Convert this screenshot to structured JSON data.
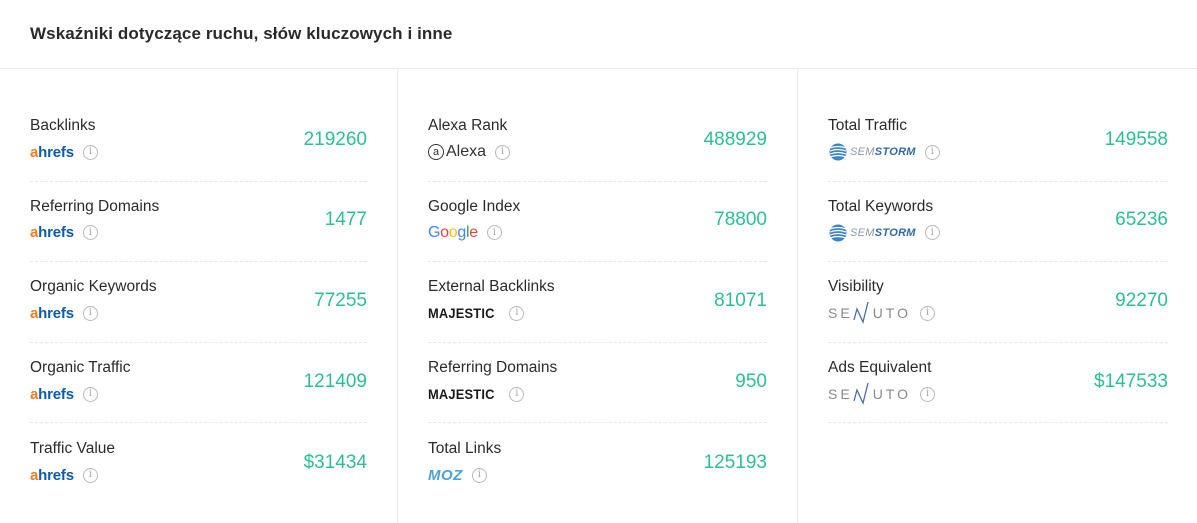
{
  "header": {
    "title": "Wskaźniki dotyczące ruchu, słów kluczowych i inne"
  },
  "columns": [
    {
      "rows": [
        {
          "label": "Backlinks",
          "source": "ahrefs",
          "value": "219260"
        },
        {
          "label": "Referring Domains",
          "source": "ahrefs",
          "value": "1477"
        },
        {
          "label": "Organic Keywords",
          "source": "ahrefs",
          "value": "77255"
        },
        {
          "label": "Organic Traffic",
          "source": "ahrefs",
          "value": "121409"
        },
        {
          "label": "Traffic Value",
          "source": "ahrefs",
          "value": "$31434"
        }
      ]
    },
    {
      "rows": [
        {
          "label": "Alexa Rank",
          "source": "Alexa",
          "value": "488929"
        },
        {
          "label": "Google Index",
          "source": "Google",
          "value": "78800"
        },
        {
          "label": "External Backlinks",
          "source": "MAJESTIC",
          "value": "81071"
        },
        {
          "label": "Referring Domains",
          "source": "MAJESTIC",
          "value": "950"
        },
        {
          "label": "Total Links",
          "source": "MOZ",
          "value": "125193"
        }
      ]
    },
    {
      "rows": [
        {
          "label": "Total Traffic",
          "source": "SEMSTORM",
          "value": "149558"
        },
        {
          "label": "Total Keywords",
          "source": "SEMSTORM",
          "value": "65236"
        },
        {
          "label": "Visibility",
          "source": "SENUTO",
          "value": "92270"
        },
        {
          "label": "Ads Equivalent",
          "source": "SENUTO",
          "value": "$147533"
        }
      ]
    }
  ],
  "logos": {
    "ahrefs_a": "a",
    "ahrefs_rest": "hrefs",
    "alexa_at": "a",
    "alexa_text": "Alexa",
    "majestic": "MAJESTIC",
    "moz": "MOZ",
    "semstorm_sem": "SEM",
    "semstorm_storm": "STORM",
    "senuto_pre": "SE",
    "senuto_post": "UTO"
  },
  "info_glyph": "i",
  "colors": {
    "value": "#2bbf98",
    "ahrefs_orange": "#f47d1a",
    "ahrefs_blue": "#0d5ca9"
  }
}
